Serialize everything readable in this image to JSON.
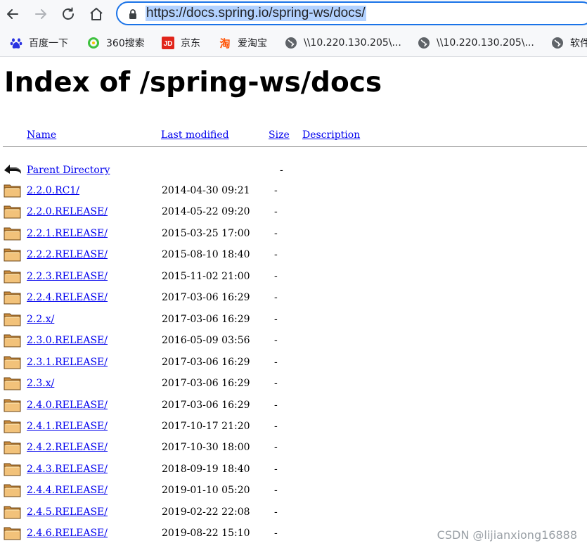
{
  "browser": {
    "url": "https://docs.spring.io/spring-ws/docs/"
  },
  "bookmarks": [
    {
      "label": "百度一下",
      "icon": "baidu-paw-icon"
    },
    {
      "label": "360搜索",
      "icon": "360-search-icon"
    },
    {
      "label": "京东",
      "icon": "jd-icon"
    },
    {
      "label": "爱淘宝",
      "icon": "taobao-icon"
    },
    {
      "label": "\\\\10.220.130.205\\...",
      "icon": "globe-icon"
    },
    {
      "label": "\\\\10.220.130.205\\...",
      "icon": "globe-icon"
    },
    {
      "label": "软件",
      "icon": "globe-icon"
    }
  ],
  "page": {
    "title": "Index of /spring-ws/docs",
    "headers": {
      "name": "Name",
      "last_modified": "Last modified",
      "size": "Size",
      "description": "Description"
    },
    "parent": {
      "name": "Parent Directory",
      "size": "-"
    },
    "rows": [
      {
        "name": "2.2.0.RC1/",
        "date": "2014-04-30 09:21",
        "size": "-"
      },
      {
        "name": "2.2.0.RELEASE/",
        "date": "2014-05-22 09:20",
        "size": "-"
      },
      {
        "name": "2.2.1.RELEASE/",
        "date": "2015-03-25 17:00",
        "size": "-"
      },
      {
        "name": "2.2.2.RELEASE/",
        "date": "2015-08-10 18:40",
        "size": "-"
      },
      {
        "name": "2.2.3.RELEASE/",
        "date": "2015-11-02 21:00",
        "size": "-"
      },
      {
        "name": "2.2.4.RELEASE/",
        "date": "2017-03-06 16:29",
        "size": "-"
      },
      {
        "name": "2.2.x/",
        "date": "2017-03-06 16:29",
        "size": "-"
      },
      {
        "name": "2.3.0.RELEASE/",
        "date": "2016-05-09 03:56",
        "size": "-"
      },
      {
        "name": "2.3.1.RELEASE/",
        "date": "2017-03-06 16:29",
        "size": "-"
      },
      {
        "name": "2.3.x/",
        "date": "2017-03-06 16:29",
        "size": "-"
      },
      {
        "name": "2.4.0.RELEASE/",
        "date": "2017-03-06 16:29",
        "size": "-"
      },
      {
        "name": "2.4.1.RELEASE/",
        "date": "2017-10-17 21:20",
        "size": "-"
      },
      {
        "name": "2.4.2.RELEASE/",
        "date": "2017-10-30 18:00",
        "size": "-"
      },
      {
        "name": "2.4.3.RELEASE/",
        "date": "2018-09-19 18:40",
        "size": "-"
      },
      {
        "name": "2.4.4.RELEASE/",
        "date": "2019-01-10 05:20",
        "size": "-"
      },
      {
        "name": "2.4.5.RELEASE/",
        "date": "2019-02-22 22:08",
        "size": "-"
      },
      {
        "name": "2.4.6.RELEASE/",
        "date": "2019-08-22 15:10",
        "size": "-"
      }
    ]
  },
  "watermark": "CSDN @lijianxiong16888",
  "colors": {
    "link": "#0000ee",
    "address_border": "#1a73e8",
    "url_highlight": "#b3d2ff"
  }
}
